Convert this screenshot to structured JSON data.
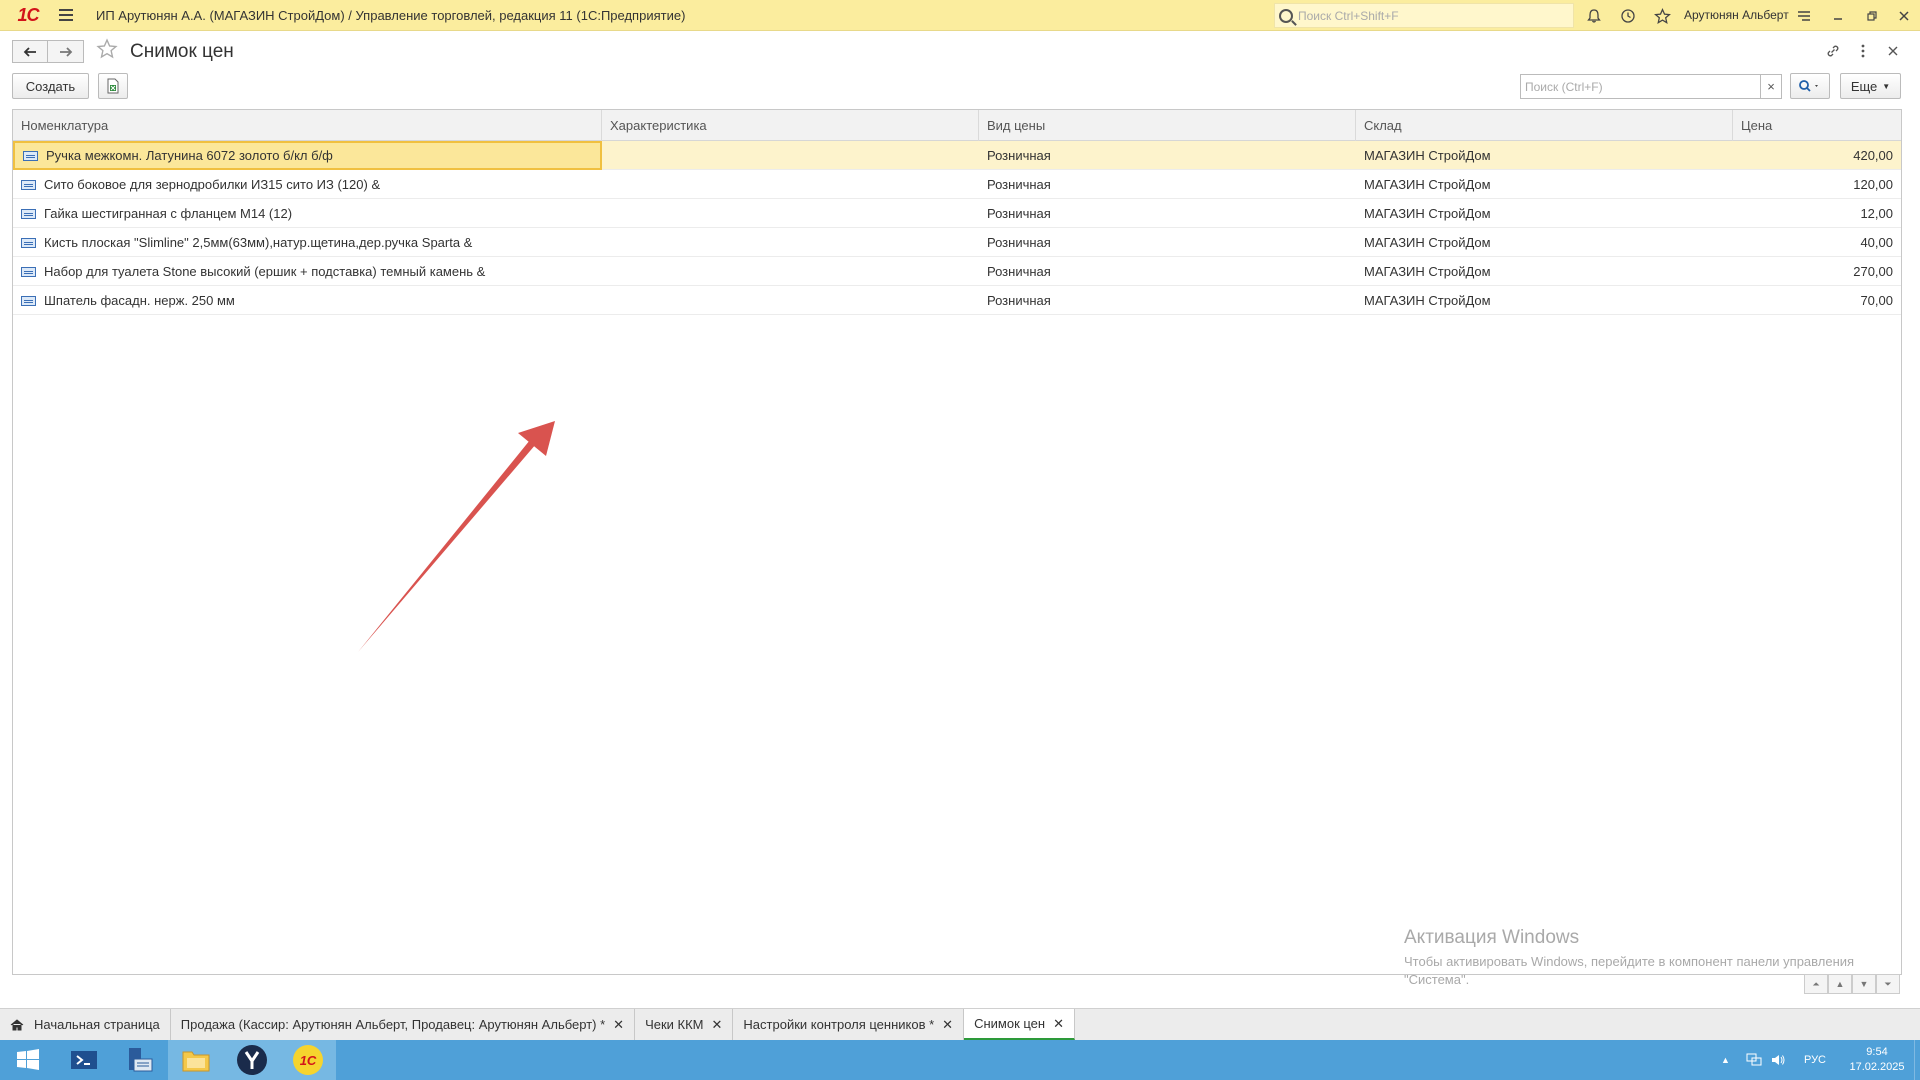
{
  "titlebar": {
    "logo": "1С",
    "title": "ИП Арутюнян А.А. (МАГАЗИН СтройДом) / Управление торговлей, редакция 11  (1С:Предприятие)",
    "search_placeholder": "Поиск Ctrl+Shift+F",
    "user": "Арутюнян Альберт"
  },
  "form": {
    "title": "Снимок цен",
    "create_label": "Создать",
    "search_placeholder": "Поиск (Ctrl+F)",
    "clear_label": "×",
    "more_label": "Еще"
  },
  "table": {
    "columns": [
      "Номенклатура",
      "Характеристика",
      "Вид цены",
      "Склад",
      "Цена"
    ],
    "rows": [
      {
        "item": "Ручка межкомн. Латунина 6072 золото б/кл б/ф",
        "characteristic": "",
        "price_type": "Розничная",
        "warehouse": "МАГАЗИН СтройДом",
        "price": "420,00"
      },
      {
        "item": "Сито боковое для зернодробилки ИЗ15 сито ИЗ (120) &",
        "characteristic": "",
        "price_type": "Розничная",
        "warehouse": "МАГАЗИН СтройДом",
        "price": "120,00"
      },
      {
        "item": "Гайка шестигранная с фланцем М14 (12)",
        "characteristic": "",
        "price_type": "Розничная",
        "warehouse": "МАГАЗИН СтройДом",
        "price": "12,00"
      },
      {
        "item": "Кисть плоская \"Slimline\" 2,5мм(63мм),натур.щетина,дер.ручка Sparta &",
        "characteristic": "",
        "price_type": "Розничная",
        "warehouse": "МАГАЗИН СтройДом",
        "price": "40,00"
      },
      {
        "item": "Набор для туалета Stone высокий (ершик + подставка) темный камень &",
        "characteristic": "",
        "price_type": "Розничная",
        "warehouse": "МАГАЗИН СтройДом",
        "price": "270,00"
      },
      {
        "item": "Шпатель фасадн. нерж. 250 мм",
        "characteristic": "",
        "price_type": "Розничная",
        "warehouse": "МАГАЗИН СтройДом",
        "price": "70,00"
      }
    ]
  },
  "watermark": {
    "line1": "Активация Windows",
    "line2": "Чтобы активировать Windows, перейдите в компонент панели управления \"Система\"."
  },
  "open_windows": [
    {
      "label": "Начальная страница",
      "closable": false
    },
    {
      "label": "Продажа (Кассир: Арутюнян Альберт, Продавец: Арутюнян Альберт) *",
      "closable": true
    },
    {
      "label": "Чеки ККМ",
      "closable": true
    },
    {
      "label": "Настройки контроля ценников *",
      "closable": true
    },
    {
      "label": "Снимок цен",
      "closable": true
    }
  ],
  "taskbar": {
    "lang": "РУС",
    "time": "9:54",
    "date": "17.02.2025"
  },
  "colors": {
    "titlebar_bg": "#fbed9e",
    "selected_row": "#fdf3cc",
    "taskbar_bg": "#4fa0d8",
    "annotation_arrow": "#d9534f"
  }
}
